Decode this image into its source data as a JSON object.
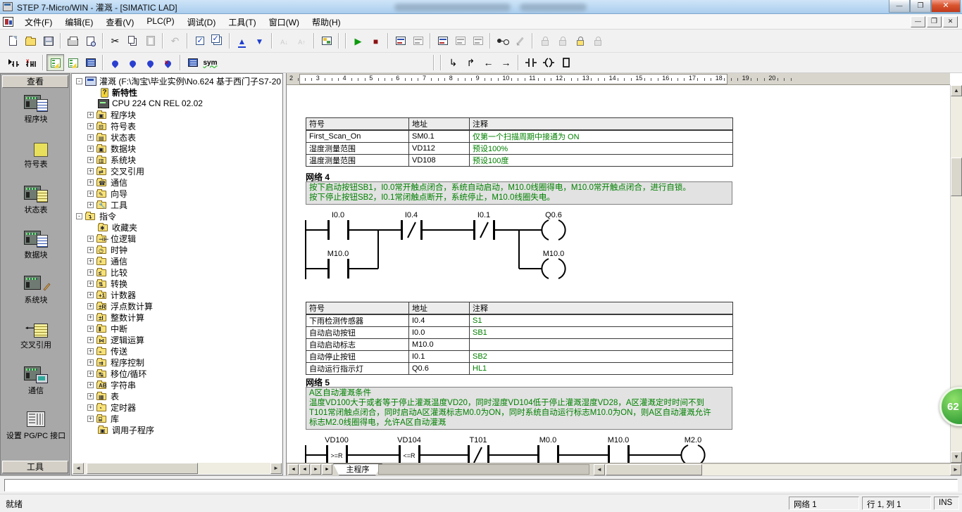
{
  "window": {
    "title": "STEP 7-Micro/WIN - 灌溉 - [SIMATIC LAD]"
  },
  "menu": {
    "items": [
      "文件(F)",
      "编辑(E)",
      "查看(V)",
      "PLC(P)",
      "调试(D)",
      "工具(T)",
      "窗口(W)",
      "帮助(H)"
    ]
  },
  "toolbar": {
    "sym_label": "sym"
  },
  "sidebar": {
    "header": "查看",
    "footer": "工具",
    "items": [
      {
        "id": "program-block",
        "label": "程序块"
      },
      {
        "id": "symbol-table",
        "label": "符号表"
      },
      {
        "id": "status-chart",
        "label": "状态表"
      },
      {
        "id": "data-block",
        "label": "数据块"
      },
      {
        "id": "system-block",
        "label": "系统块"
      },
      {
        "id": "cross-reference",
        "label": "交叉引用"
      },
      {
        "id": "communications",
        "label": "通信"
      },
      {
        "id": "set-pgpc",
        "label": "设置 PG/PC 接口"
      }
    ]
  },
  "tree": {
    "items": [
      {
        "level": 0,
        "icon": "proj",
        "exp": "-",
        "label": "灌溉 (F:\\淘宝\\毕业实例\\No.624 基于西门子S7-20",
        "bold": false
      },
      {
        "level": 1,
        "icon": "q",
        "exp": "",
        "label": "新特性",
        "bold": true
      },
      {
        "level": 1,
        "icon": "cpu",
        "exp": "",
        "label": "CPU 224 CN REL 02.02",
        "bold": false
      },
      {
        "level": 1,
        "icon": "folder",
        "mark": "▣",
        "exp": "+",
        "label": "程序块",
        "bold": false
      },
      {
        "level": 1,
        "icon": "folder",
        "mark": "⊡",
        "exp": "+",
        "label": "符号表",
        "bold": false
      },
      {
        "level": 1,
        "icon": "folder",
        "mark": "▤",
        "exp": "+",
        "label": "状态表",
        "bold": false
      },
      {
        "level": 1,
        "icon": "folder",
        "mark": "▣",
        "exp": "+",
        "label": "数据块",
        "bold": false
      },
      {
        "level": 1,
        "icon": "folder",
        "mark": "▥",
        "exp": "+",
        "label": "系统块",
        "bold": false
      },
      {
        "level": 1,
        "icon": "folder",
        "mark": "⇄",
        "exp": "+",
        "label": "交叉引用",
        "bold": false
      },
      {
        "level": 1,
        "icon": "folder",
        "mark": "☎",
        "exp": "+",
        "label": "通信",
        "bold": false
      },
      {
        "level": 1,
        "icon": "folder",
        "mark": "✎",
        "exp": "+",
        "label": "向导",
        "bold": false
      },
      {
        "level": 1,
        "icon": "folder",
        "mark": "🔧",
        "exp": "+",
        "label": "工具",
        "bold": false
      },
      {
        "level": 0,
        "icon": "folder",
        "mark": "↴",
        "exp": "-",
        "label": "指令",
        "bold": false
      },
      {
        "level": 1,
        "icon": "folder",
        "mark": "✱",
        "exp": "",
        "label": "收藏夹",
        "bold": false
      },
      {
        "level": 1,
        "icon": "folder",
        "mark": "⊣⊢",
        "exp": "+",
        "label": "位逻辑",
        "bold": false
      },
      {
        "level": 1,
        "icon": "folder",
        "mark": "◷",
        "exp": "+",
        "label": "时钟",
        "bold": false
      },
      {
        "level": 1,
        "icon": "folder",
        "mark": "⚡",
        "exp": "+",
        "label": "通信",
        "bold": false
      },
      {
        "level": 1,
        "icon": "folder",
        "mark": "≤",
        "exp": "+",
        "label": "比较",
        "bold": false
      },
      {
        "level": 1,
        "icon": "folder",
        "mark": "⇅",
        "exp": "+",
        "label": "转换",
        "bold": false
      },
      {
        "level": 1,
        "icon": "folder",
        "mark": "+1",
        "exp": "+",
        "label": "计数器",
        "bold": false
      },
      {
        "level": 1,
        "icon": "folder",
        "mark": "±R",
        "exp": "+",
        "label": "浮点数计算",
        "bold": false
      },
      {
        "level": 1,
        "icon": "folder",
        "mark": "±I",
        "exp": "+",
        "label": "整数计算",
        "bold": false
      },
      {
        "level": 1,
        "icon": "folder",
        "mark": "⦀",
        "exp": "+",
        "label": "中断",
        "bold": false
      },
      {
        "level": 1,
        "icon": "folder",
        "mark": "⋈",
        "exp": "+",
        "label": "逻辑运算",
        "bold": false
      },
      {
        "level": 1,
        "icon": "folder",
        "mark": "⌁",
        "exp": "+",
        "label": "传送",
        "bold": false
      },
      {
        "level": 1,
        "icon": "folder",
        "mark": "⇉",
        "exp": "+",
        "label": "程序控制",
        "bold": false
      },
      {
        "level": 1,
        "icon": "folder",
        "mark": "↹",
        "exp": "+",
        "label": "移位/循环",
        "bold": false
      },
      {
        "level": 1,
        "icon": "folder",
        "mark": "AB",
        "exp": "+",
        "label": "字符串",
        "bold": false
      },
      {
        "level": 1,
        "icon": "folder",
        "mark": "▦",
        "exp": "+",
        "label": "表",
        "bold": false
      },
      {
        "level": 1,
        "icon": "folder",
        "mark": "◔",
        "exp": "+",
        "label": "定时器",
        "bold": false
      },
      {
        "level": 1,
        "icon": "folder",
        "mark": "⌸",
        "exp": "+",
        "label": "库",
        "bold": false
      },
      {
        "level": 1,
        "icon": "folder",
        "mark": "▣",
        "exp": "",
        "label": "调用子程序",
        "bold": false
      }
    ]
  },
  "editor": {
    "ruler": [
      2,
      3,
      4,
      5,
      6,
      7,
      8,
      9,
      10,
      11,
      12,
      13,
      14,
      15,
      16,
      17,
      18,
      19,
      20
    ],
    "table1": {
      "headers": [
        "符号",
        "地址",
        "注释"
      ],
      "rows": [
        [
          "First_Scan_On",
          "SM0.1",
          "仅第一个扫描周期中接通为 ON"
        ],
        [
          "湿度测量范围",
          "VD112",
          "预设100%"
        ],
        [
          "温度测量范围",
          "VD108",
          "预设100度"
        ]
      ]
    },
    "net4": {
      "title": "网络 4",
      "comment": [
        "按下启动按钮SB1，I0.0常开触点闭合，系统自动启动，M10.0线圈得电，M10.0常开触点闭合，进行自锁。",
        "按下停止按钮SB2，I0.1常闭触点断开，系统停止，M10.0线圈失电。"
      ],
      "labels": {
        "c1": "I0.0",
        "c2": "I0.4",
        "c3": "I0.1",
        "coil1": "Q0.6",
        "c4": "M10.0",
        "coil2": "M10.0"
      }
    },
    "table2": {
      "headers": [
        "符号",
        "地址",
        "注释"
      ],
      "rows": [
        [
          "下雨检测传感器",
          "I0.4",
          "S1"
        ],
        [
          "自动启动按钮",
          "I0.0",
          "SB1"
        ],
        [
          "自动启动标志",
          "M10.0",
          ""
        ],
        [
          "自动停止按钮",
          "I0.1",
          "SB2"
        ],
        [
          "自动运行指示灯",
          "Q0.6",
          "HL1"
        ]
      ]
    },
    "net5": {
      "title": "网络 5",
      "comment": [
        "A区自动灌溉条件",
        "温度VD100大于或者等于停止灌溉温度VD20，同时湿度VD104低于停止灌溉湿度VD28，A区灌溉定时时间不到",
        "T101常闭触点闭合，同时启动A区灌溉标志M0.0为ON，同时系统自动运行标志M10.0为ON，则A区自动灌溉允许",
        "标志M2.0线圈得电，允许A区自动灌溉"
      ],
      "labels": {
        "c1": "VD100",
        "op1": ">=R",
        "c2": "VD104",
        "op2": "<=R",
        "c3": "T101",
        "c4": "M0.0",
        "c5": "M10.0",
        "coil": "M2.0"
      }
    },
    "tab": "主程序"
  },
  "statusbar": {
    "ready": "就绪",
    "network": "网络 1",
    "position": "行 1, 列 1",
    "mode": "INS"
  },
  "badge": {
    "text": "62"
  }
}
